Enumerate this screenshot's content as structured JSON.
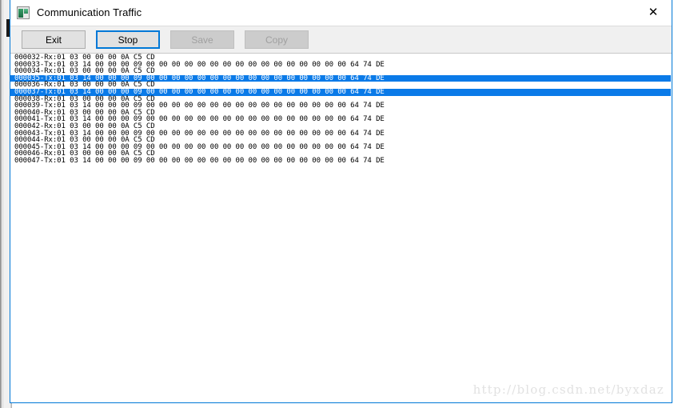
{
  "window": {
    "title": "Communication Traffic",
    "icon": "app-window-icon",
    "close_label": "✕",
    "border_color": "#0078d7"
  },
  "toolbar": {
    "buttons": [
      {
        "label": "Exit",
        "state": "normal",
        "name": "exit-button"
      },
      {
        "label": "Stop",
        "state": "focused",
        "name": "stop-button"
      },
      {
        "label": "Save",
        "state": "disabled",
        "name": "save-button"
      },
      {
        "label": "Copy",
        "state": "disabled",
        "name": "copy-button"
      }
    ],
    "focus_color": "#0078d7"
  },
  "log": {
    "selection_color": "#0a7ae8",
    "lines": [
      {
        "text": "000032-Rx:01 03 00 00 00 0A C5 CD",
        "selected": false
      },
      {
        "text": "000033-Tx:01 03 14 00 00 00 09 00 00 00 00 00 00 00 00 00 00 00 00 00 00 00 00 64 74 DE",
        "selected": false
      },
      {
        "text": "000034-Rx:01 03 00 00 00 0A C5 CD",
        "selected": false
      },
      {
        "text": "000035-Tx:01 03 14 00 00 00 09 00 00 00 00 00 00 00 00 00 00 00 00 00 00 00 00 64 74 DE",
        "selected": true
      },
      {
        "text": "000036-Rx:01 03 00 00 00 0A C5 CD",
        "selected": false
      },
      {
        "text": "000037-Tx:01 03 14 00 00 00 09 00 00 00 00 00 00 00 00 00 00 00 00 00 00 00 00 64 74 DE",
        "selected": true
      },
      {
        "text": "000038-Rx:01 03 00 00 00 0A C5 CD",
        "selected": false
      },
      {
        "text": "000039-Tx:01 03 14 00 00 00 09 00 00 00 00 00 00 00 00 00 00 00 00 00 00 00 00 64 74 DE",
        "selected": false
      },
      {
        "text": "000040-Rx:01 03 00 00 00 0A C5 CD",
        "selected": false
      },
      {
        "text": "000041-Tx:01 03 14 00 00 00 09 00 00 00 00 00 00 00 00 00 00 00 00 00 00 00 00 64 74 DE",
        "selected": false
      },
      {
        "text": "000042-Rx:01 03 00 00 00 0A C5 CD",
        "selected": false
      },
      {
        "text": "000043-Tx:01 03 14 00 00 00 09 00 00 00 00 00 00 00 00 00 00 00 00 00 00 00 00 64 74 DE",
        "selected": false
      },
      {
        "text": "000044-Rx:01 03 00 00 00 0A C5 CD",
        "selected": false
      },
      {
        "text": "000045-Tx:01 03 14 00 00 00 09 00 00 00 00 00 00 00 00 00 00 00 00 00 00 00 00 64 74 DE",
        "selected": false
      },
      {
        "text": "000046-Rx:01 03 00 00 00 0A C5 CD",
        "selected": false
      },
      {
        "text": "000047-Tx:01 03 14 00 00 00 09 00 00 00 00 00 00 00 00 00 00 00 00 00 00 00 00 64 74 DE",
        "selected": false
      }
    ]
  },
  "watermark": {
    "text": "http://blog.csdn.net/byxdaz"
  }
}
